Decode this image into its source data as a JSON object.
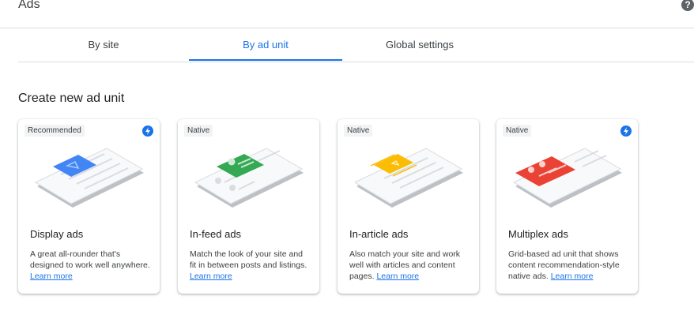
{
  "header": {
    "title": "Ads",
    "help_glyph": "?"
  },
  "tabs": [
    {
      "label": "By site",
      "active": false
    },
    {
      "label": "By ad unit",
      "active": true
    },
    {
      "label": "Global settings",
      "active": false
    }
  ],
  "section": {
    "title": "Create new ad unit"
  },
  "cards": [
    {
      "badge": "Recommended",
      "has_bolt": true,
      "title": "Display ads",
      "description": "A great all-rounder that's designed to work well anywhere.",
      "link": "Learn more",
      "accent": "#4285f4"
    },
    {
      "badge": "Native",
      "has_bolt": false,
      "title": "In-feed ads",
      "description": "Match the look of your site and fit in between posts and listings.",
      "link": "Learn more",
      "accent": "#34a853"
    },
    {
      "badge": "Native",
      "has_bolt": false,
      "title": "In-article ads",
      "description": "Also match your site and work well with articles and content pages.",
      "link": "Learn more",
      "accent": "#fbbc04"
    },
    {
      "badge": "Native",
      "has_bolt": true,
      "title": "Multiplex ads",
      "description": "Grid-based ad unit that shows content recommendation-style native ads.",
      "link": "Learn more",
      "accent": "#ea4335"
    }
  ],
  "colors": {
    "link": "#1a73e8",
    "active_tab": "#1a73e8",
    "divider": "#dadce0"
  }
}
